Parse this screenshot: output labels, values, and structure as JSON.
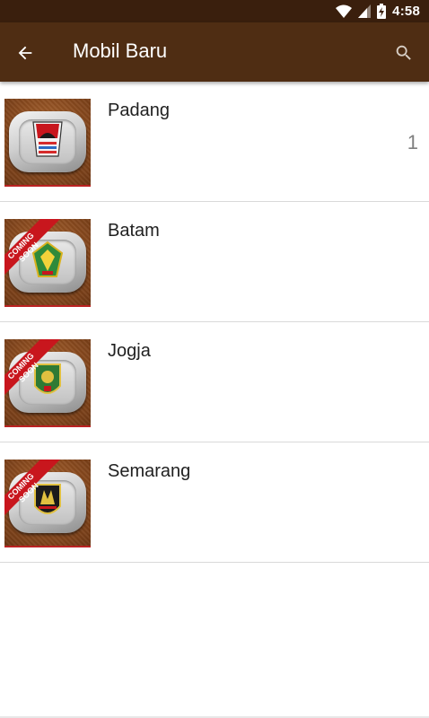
{
  "status_bar": {
    "time": "4:58"
  },
  "app_bar": {
    "title": "Mobil Baru"
  },
  "cities": [
    {
      "name": "Padang",
      "count": "1",
      "ribbon": null
    },
    {
      "name": "Batam",
      "count": "",
      "ribbon": "COMING SOON"
    },
    {
      "name": "Jogja",
      "count": "",
      "ribbon": "COMING SOON"
    },
    {
      "name": "Semarang",
      "count": "",
      "ribbon": "COMING SOON"
    }
  ],
  "colors": {
    "status_bar": "#3a1f0d",
    "app_bar": "#4f2d13",
    "thumb_brown": "#8a4b1f",
    "ribbon_red": "#c8161d"
  }
}
